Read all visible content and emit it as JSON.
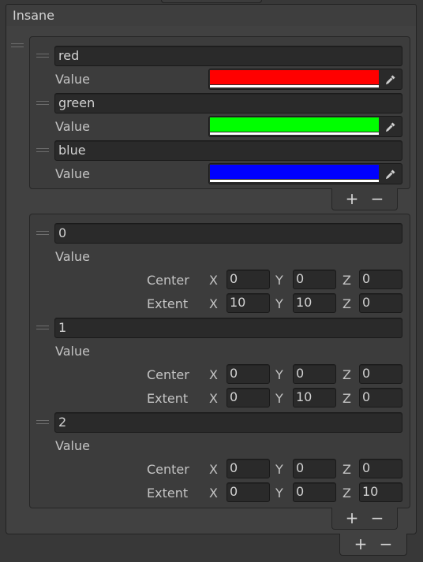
{
  "header": {
    "title": "Insane"
  },
  "color_list": {
    "items": [
      {
        "name": "red",
        "value_label": "Value",
        "color": "#ff0000"
      },
      {
        "name": "green",
        "value_label": "Value",
        "color": "#00ff00"
      },
      {
        "name": "blue",
        "value_label": "Value",
        "color": "#0000ff"
      }
    ],
    "footer": {
      "add": "+",
      "remove": "−"
    }
  },
  "bounds_list": {
    "items": [
      {
        "name": "0",
        "value_label": "Value",
        "center": {
          "label": "Center",
          "x": "0",
          "y": "0",
          "z": "0"
        },
        "extent": {
          "label": "Extent",
          "x": "10",
          "y": "10",
          "z": "0"
        }
      },
      {
        "name": "1",
        "value_label": "Value",
        "center": {
          "label": "Center",
          "x": "0",
          "y": "0",
          "z": "0"
        },
        "extent": {
          "label": "Extent",
          "x": "0",
          "y": "10",
          "z": "0"
        }
      },
      {
        "name": "2",
        "value_label": "Value",
        "center": {
          "label": "Center",
          "x": "0",
          "y": "0",
          "z": "0"
        },
        "extent": {
          "label": "Extent",
          "x": "0",
          "y": "0",
          "z": "10"
        }
      }
    ],
    "footer": {
      "add": "+",
      "remove": "−"
    }
  },
  "outer_footer": {
    "add": "+",
    "remove": "−"
  },
  "axes": {
    "x": "X",
    "y": "Y",
    "z": "Z"
  },
  "icons": {
    "picker": "eyedropper-icon",
    "handle": "drag-handle-icon"
  }
}
